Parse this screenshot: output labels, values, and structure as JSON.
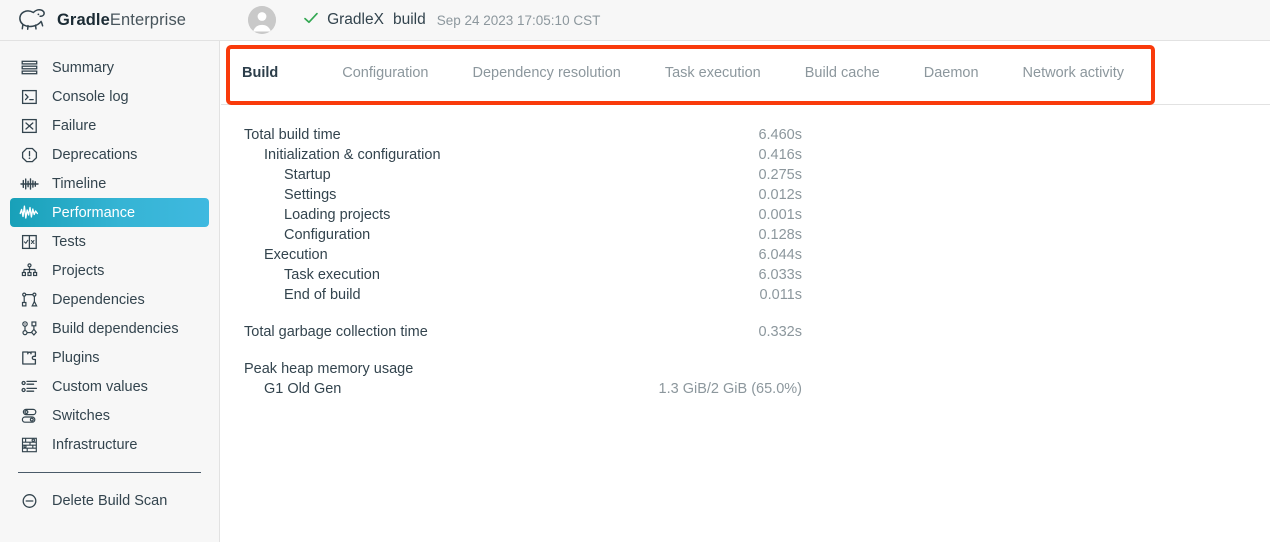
{
  "brand": {
    "name_bold": "Gradle",
    "name_light": "Enterprise",
    "logo_icon": "gradle-elephant-logo"
  },
  "header": {
    "avatar_icon": "user-avatar-icon",
    "status_icon": "check-success-icon",
    "project": "GradleX",
    "build_type": "build",
    "timestamp": "Sep 24 2023 17:05:10 CST"
  },
  "sidebar": {
    "items": [
      {
        "label": "Summary",
        "icon": "summary-icon",
        "active": false
      },
      {
        "label": "Console log",
        "icon": "console-log-icon",
        "active": false
      },
      {
        "label": "Failure",
        "icon": "failure-icon",
        "active": false
      },
      {
        "label": "Deprecations",
        "icon": "deprecations-icon",
        "active": false
      },
      {
        "label": "Timeline",
        "icon": "timeline-icon",
        "active": false
      },
      {
        "label": "Performance",
        "icon": "performance-icon",
        "active": true
      },
      {
        "label": "Tests",
        "icon": "tests-icon",
        "active": false
      },
      {
        "label": "Projects",
        "icon": "projects-icon",
        "active": false
      },
      {
        "label": "Dependencies",
        "icon": "dependencies-icon",
        "active": false
      },
      {
        "label": "Build dependencies",
        "icon": "build-dependencies-icon",
        "active": false
      },
      {
        "label": "Plugins",
        "icon": "plugins-icon",
        "active": false
      },
      {
        "label": "Custom values",
        "icon": "custom-values-icon",
        "active": false
      },
      {
        "label": "Switches",
        "icon": "switches-icon",
        "active": false
      },
      {
        "label": "Infrastructure",
        "icon": "infrastructure-icon",
        "active": false
      }
    ],
    "delete_action": {
      "label": "Delete Build Scan",
      "icon": "minus-circle-icon"
    }
  },
  "tabs": [
    {
      "label": "Build",
      "active": true
    },
    {
      "label": "Configuration",
      "active": false
    },
    {
      "label": "Dependency resolution",
      "active": false
    },
    {
      "label": "Task execution",
      "active": false
    },
    {
      "label": "Build cache",
      "active": false
    },
    {
      "label": "Daemon",
      "active": false
    },
    {
      "label": "Network activity",
      "active": false
    }
  ],
  "performance": {
    "build_time_rows": [
      {
        "label": "Total build time",
        "value": "6.460s",
        "level": 0
      },
      {
        "label": "Initialization & configuration",
        "value": "0.416s",
        "level": 1
      },
      {
        "label": "Startup",
        "value": "0.275s",
        "level": 2
      },
      {
        "label": "Settings",
        "value": "0.012s",
        "level": 2
      },
      {
        "label": "Loading projects",
        "value": "0.001s",
        "level": 2
      },
      {
        "label": "Configuration",
        "value": "0.128s",
        "level": 2
      },
      {
        "label": "Execution",
        "value": "6.044s",
        "level": 1
      },
      {
        "label": "Task execution",
        "value": "6.033s",
        "level": 2
      },
      {
        "label": "End of build",
        "value": "0.011s",
        "level": 2
      }
    ],
    "gc_rows": [
      {
        "label": "Total garbage collection time",
        "value": "0.332s",
        "level": 0
      }
    ],
    "heap_heading": {
      "label": "Peak heap memory usage",
      "level": 0
    },
    "heap_rows": [
      {
        "label": "G1 Old Gen",
        "value": "1.3 GiB/2 GiB (65.0%)",
        "level": 1
      }
    ]
  },
  "colors": {
    "accent_active": "#35b4d4",
    "highlight_box": "#f93a0b",
    "success_check": "#34a853",
    "text_primary": "#33444e",
    "text_muted": "#8c979d",
    "sidebar_bg": "#f7f7f7"
  }
}
